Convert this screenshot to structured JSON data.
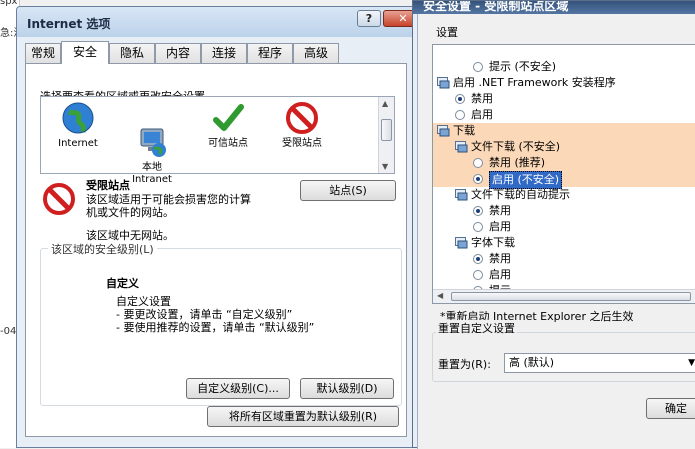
{
  "background": {
    "left_texts": [
      "spx",
      "急:注",
      "-04"
    ]
  },
  "internet_options": {
    "title": "Internet 选项",
    "help_button": "?",
    "close_button": "X",
    "tabs": [
      "常规",
      "安全",
      "隐私",
      "内容",
      "连接",
      "程序",
      "高级"
    ],
    "active_tab": "安全",
    "select_zone_prompt": "选择要查看的区域或更改安全设置。",
    "zones": [
      {
        "label": "Internet",
        "icon": "globe-icon"
      },
      {
        "label": "本地\nIntranet",
        "icon": "local-intranet-icon"
      },
      {
        "label": "可信站点",
        "icon": "checkmark-icon"
      },
      {
        "label": "受限站点",
        "icon": "restricted-icon"
      }
    ],
    "selected_zone": {
      "name": "受限站点",
      "description_line1": "该区域适用于可能会损害您的计算",
      "description_line2": "机或文件的网站。",
      "no_sites": "该区域中无网站。",
      "sites_button": "站点(S)"
    },
    "security_level_group": "该区域的安全级别(L)",
    "custom": {
      "title": "自定义",
      "line1": "自定义设置",
      "line2": "- 要更改设置，请单击 “自定义级别”",
      "line3": "- 要使用推荐的设置，请单击 “默认级别”"
    },
    "custom_level_button": "自定义级别(C)...",
    "default_level_button": "默认级别(D)",
    "reset_all_button": "将所有区域重置为默认级别(R)"
  },
  "security_settings": {
    "title": "安全设置 - 受限制站点区域",
    "settings_label": "设置",
    "tree": [
      {
        "type": "radio",
        "label": "提示 (不安全)",
        "checked": false,
        "indent": 2
      },
      {
        "type": "group",
        "label": "启用 .NET Framework 安装程序",
        "indent": 0
      },
      {
        "type": "radio",
        "label": "禁用",
        "checked": true,
        "indent": 1
      },
      {
        "type": "radio",
        "label": "启用",
        "checked": false,
        "indent": 1
      },
      {
        "type": "group",
        "label": "下载",
        "indent": 0,
        "selected": true
      },
      {
        "type": "group",
        "label": "文件下载 (不安全)",
        "indent": 1,
        "selected": true
      },
      {
        "type": "radio",
        "label": "禁用 (推荐)",
        "checked": false,
        "indent": 2,
        "selected": true
      },
      {
        "type": "radio",
        "label": "启用 (不安全)",
        "checked": true,
        "indent": 2,
        "selected": true,
        "highlight": true
      },
      {
        "type": "group",
        "label": "文件下载的自动提示",
        "indent": 1
      },
      {
        "type": "radio",
        "label": "禁用",
        "checked": true,
        "indent": 2
      },
      {
        "type": "radio",
        "label": "启用",
        "checked": false,
        "indent": 2
      },
      {
        "type": "group",
        "label": "字体下载",
        "indent": 1
      },
      {
        "type": "radio",
        "label": "禁用",
        "checked": true,
        "indent": 2
      },
      {
        "type": "radio",
        "label": "启用",
        "checked": false,
        "indent": 2
      },
      {
        "type": "radio",
        "label": "提示",
        "checked": false,
        "indent": 2
      }
    ],
    "restart_note": "*重新启动 Internet Explorer 之后生效",
    "reset_group": "重置自定义设置",
    "reset_to_label": "重置为(R):",
    "reset_to_value": "高 (默认)",
    "ok_button": "确定"
  }
}
